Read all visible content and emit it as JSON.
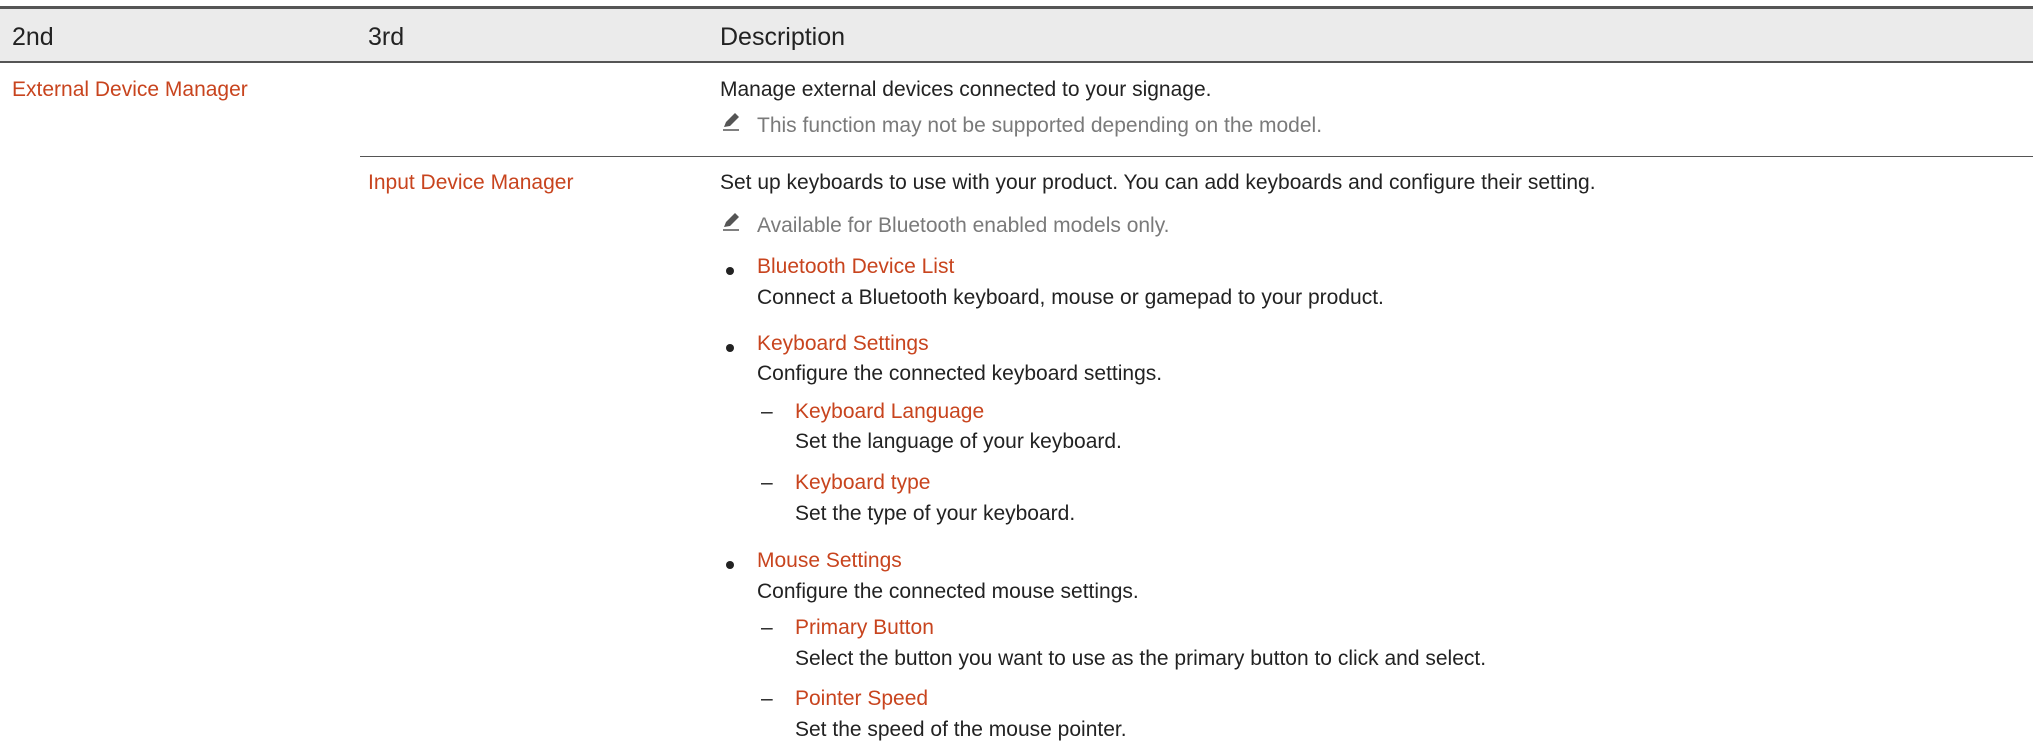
{
  "table": {
    "headers": [
      "2nd",
      "3rd",
      "Description"
    ],
    "row1": {
      "col2": "External Device Manager",
      "description": "Manage external devices connected to your signage.",
      "note": "This function may not be supported depending on the model."
    },
    "row2": {
      "col3": "Input Device Manager",
      "description": "Set up keyboards to use with your product. You can add keyboards and configure their setting.",
      "note": "Available for Bluetooth enabled models only.",
      "items": [
        {
          "title": "Bluetooth Device List",
          "desc": "Connect a Bluetooth keyboard, mouse or gamepad to your product."
        },
        {
          "title": "Keyboard Settings",
          "desc": "Configure the connected keyboard settings.",
          "subitems": [
            {
              "title": "Keyboard Language",
              "desc": "Set the language of your keyboard."
            },
            {
              "title": "Keyboard type",
              "desc": "Set the type of your keyboard."
            }
          ]
        },
        {
          "title": "Mouse Settings",
          "desc": "Configure the connected mouse settings.",
          "subitems": [
            {
              "title": "Primary Button",
              "desc": "Select the button you want to use as the primary button to click and select."
            },
            {
              "title": "Pointer Speed",
              "desc": "Set the speed of the mouse pointer."
            }
          ]
        }
      ]
    }
  },
  "icons": {
    "note": "pencil-note-icon"
  },
  "colors": {
    "accent": "#c8441e",
    "note_text": "#7a7a7a",
    "body_text": "#222222",
    "header_bg": "#ebebeb"
  }
}
